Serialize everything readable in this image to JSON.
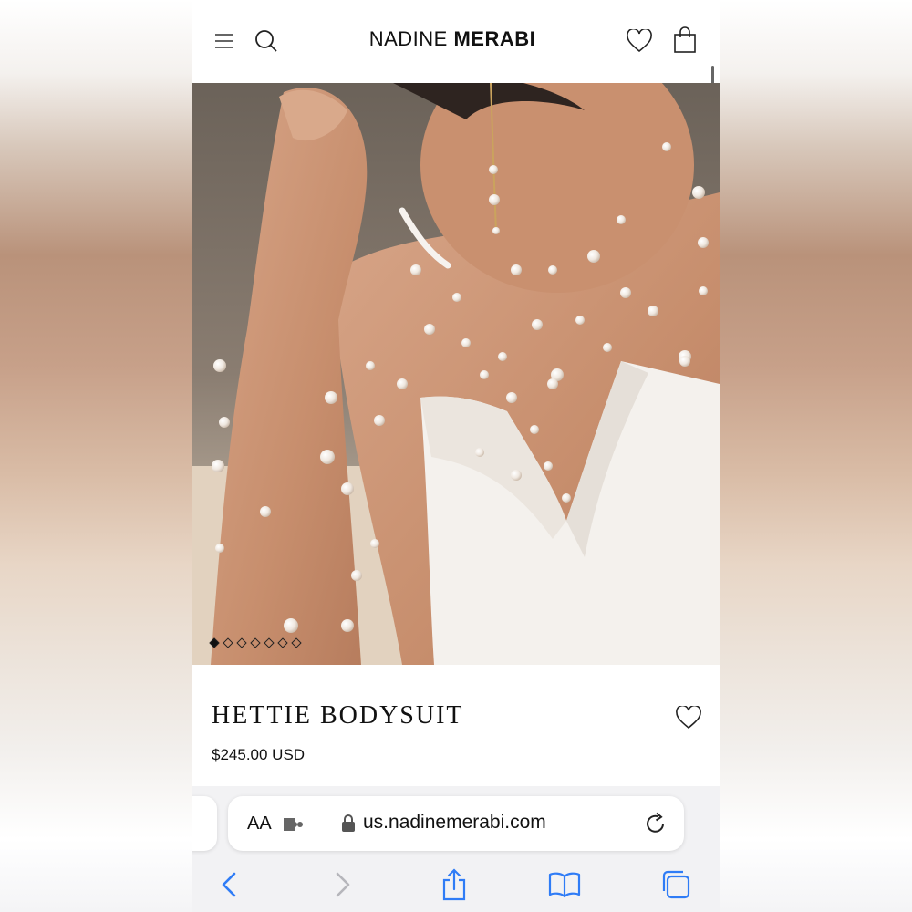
{
  "header": {
    "brand_light": "NADINE",
    "brand_bold": "MERABI",
    "icons": [
      "menu-icon",
      "search-icon",
      "heart-icon",
      "bag-icon"
    ]
  },
  "carousel": {
    "slide_count": 7,
    "active_index": 0
  },
  "product": {
    "title": "HETTIE BODYSUIT",
    "price": "$245.00 USD"
  },
  "browser": {
    "aa_label": "AA",
    "url": "us.nadinemerabi.com",
    "icons": [
      "extension-icon",
      "lock-icon",
      "reload-icon",
      "back-icon",
      "forward-icon",
      "share-icon",
      "bookmarks-icon",
      "tabs-icon"
    ]
  },
  "colors": {
    "accent_ios_blue": "#2f7cf6",
    "text": "#111111",
    "skin": "#c9977a",
    "fabric": "#f3f0ec"
  }
}
